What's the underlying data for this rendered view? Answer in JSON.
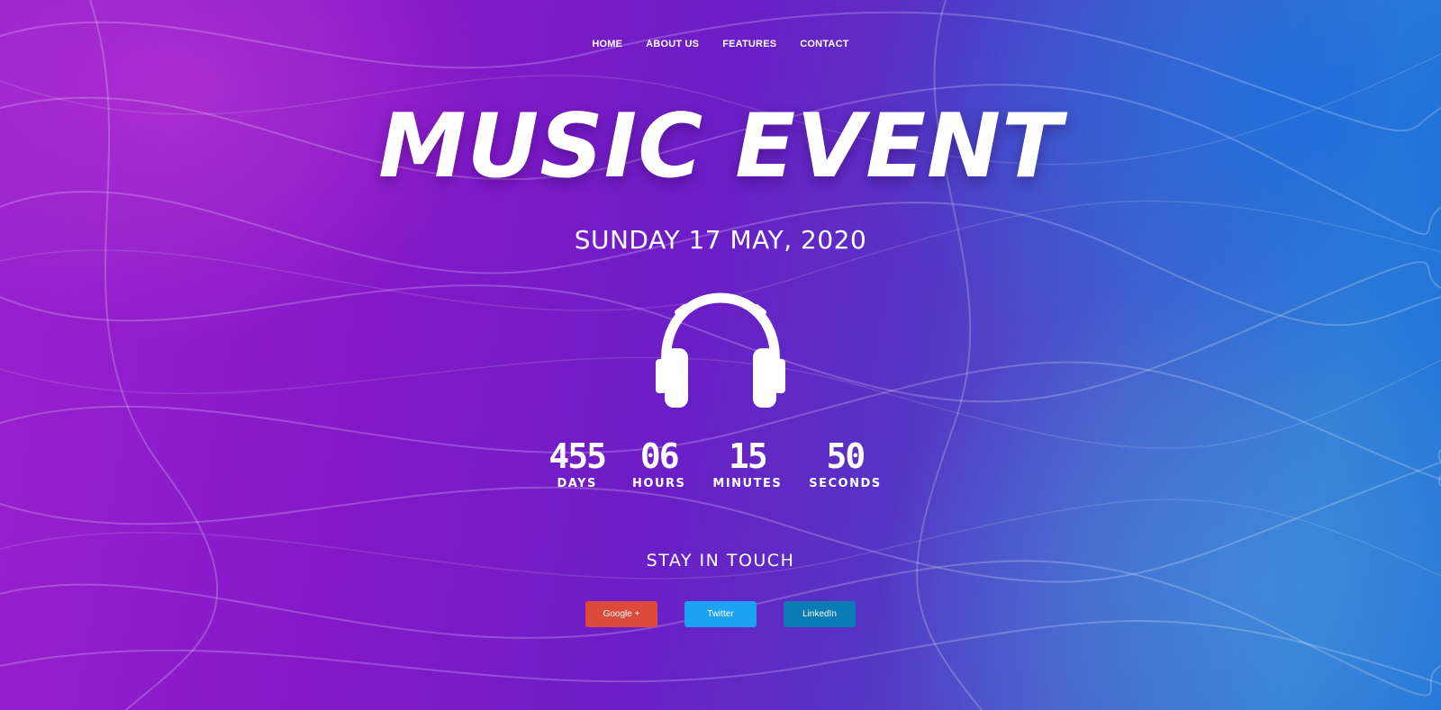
{
  "nav": {
    "items": [
      {
        "label": "HOME"
      },
      {
        "label": "ABOUT US"
      },
      {
        "label": "FEATURES"
      },
      {
        "label": "CONTACT"
      }
    ]
  },
  "hero": {
    "title": "MUSIC EVENT",
    "date": "SUNDAY 17 MAY, 2020",
    "icon": "headphones-icon"
  },
  "countdown": [
    {
      "value": "455",
      "label": "DAYS"
    },
    {
      "value": "06",
      "label": "HOURS"
    },
    {
      "value": "15",
      "label": "MINUTES"
    },
    {
      "value": "50",
      "label": "SECONDS"
    }
  ],
  "contact": {
    "heading": "STAY IN TOUCH",
    "buttons": [
      {
        "label": "Google +",
        "color": "#dc4b39"
      },
      {
        "label": "Twitter",
        "color": "#1da1f2"
      },
      {
        "label": "LinkedIn",
        "color": "#0a7bb5"
      }
    ]
  },
  "colors": {
    "bg_left": "#9a22cf",
    "bg_mid": "#6b1ec6",
    "bg_right": "#1b72d8"
  }
}
